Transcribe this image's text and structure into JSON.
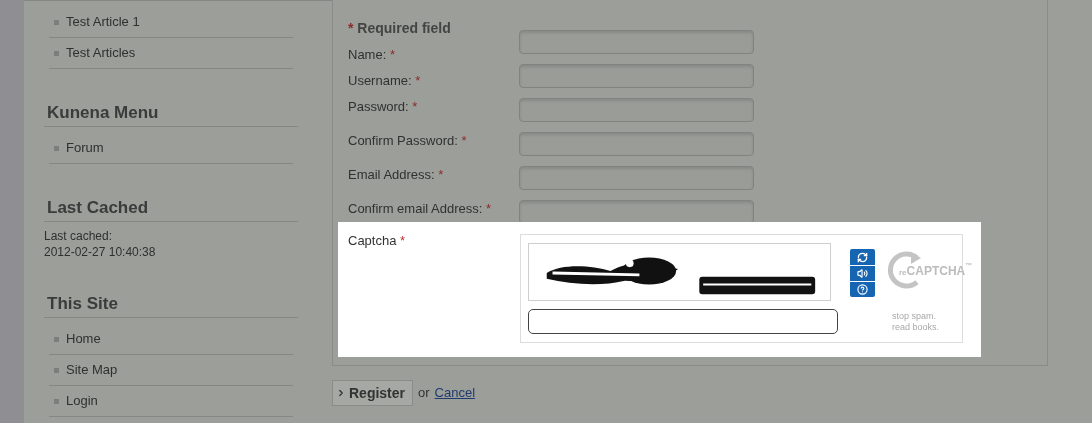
{
  "sidebar": {
    "sections": [
      {
        "kind": "menu",
        "items": [
          "Test Article 1",
          "Test Articles"
        ]
      },
      {
        "kind": "menu",
        "title": "Kunena Menu",
        "items": [
          "Forum"
        ]
      },
      {
        "kind": "text",
        "title": "Last Cached",
        "lines": [
          "Last cached:",
          "2012-02-27 10:40:38"
        ]
      },
      {
        "kind": "menu",
        "title": "This Site",
        "items": [
          "Home",
          "Site Map",
          "Login"
        ]
      }
    ]
  },
  "form": {
    "required_note": {
      "mark": "*",
      "text": "Required field"
    },
    "fields": [
      {
        "label": "Name:",
        "mark": "*"
      },
      {
        "label": "Username:",
        "mark": "*"
      },
      {
        "label": "Password:",
        "mark": "*"
      },
      {
        "label": "Confirm Password:",
        "mark": "*"
      },
      {
        "label": "Email Address:",
        "mark": "*"
      },
      {
        "label": "Confirm email Address:",
        "mark": "*"
      }
    ],
    "captcha": {
      "label": "Captcha",
      "mark": "*",
      "logo": {
        "prefix": "re",
        "name": "CAPTCHA",
        "tm": "™"
      },
      "tagline": [
        "stop spam.",
        "read books."
      ]
    },
    "actions": {
      "submit": "Register",
      "separator": "or",
      "cancel": "Cancel"
    }
  }
}
